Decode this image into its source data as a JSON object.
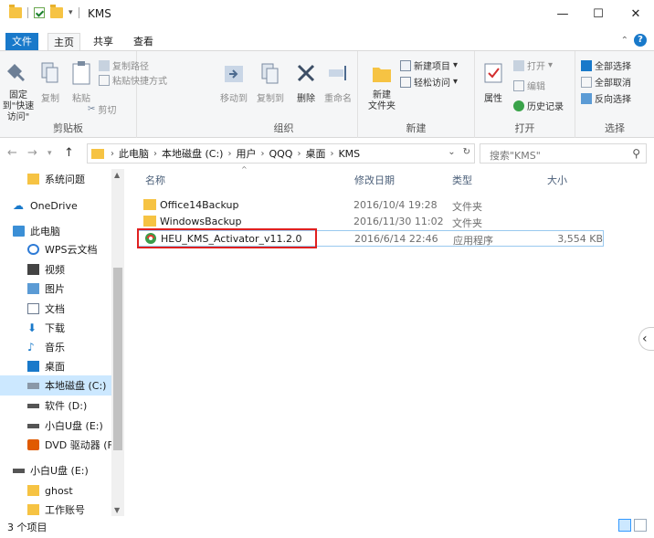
{
  "window": {
    "title": "KMS",
    "minimize": "—",
    "maximize": "☐",
    "close": "✕"
  },
  "ribbon_tabs": {
    "file": "文件",
    "home": "主页",
    "share": "共享",
    "view": "查看"
  },
  "ribbon": {
    "clipboard": {
      "pin": "固定到\"快速访问\"",
      "copy": "复制",
      "paste": "粘贴",
      "copy_path": "复制路径",
      "paste_shortcut": "粘贴快捷方式",
      "cut": "剪切",
      "label": "剪贴板"
    },
    "organize": {
      "move_to": "移动到",
      "copy_to": "复制到",
      "delete": "删除",
      "rename": "重命名",
      "label": "组织"
    },
    "new": {
      "new_folder": "新建\n文件夹",
      "new_item": "新建项目",
      "easy_access": "轻松访问",
      "label": "新建"
    },
    "open": {
      "properties": "属性",
      "open": "打开",
      "edit": "编辑",
      "history": "历史记录",
      "label": "打开"
    },
    "select": {
      "select_all": "全部选择",
      "select_none": "全部取消",
      "invert": "反向选择",
      "label": "选择"
    }
  },
  "address": {
    "crumbs": [
      "此电脑",
      "本地磁盘 (C:)",
      "用户",
      "QQQ",
      "桌面",
      "KMS"
    ],
    "search_placeholder": "搜索\"KMS\""
  },
  "nav": {
    "items": [
      {
        "label": "系统问题",
        "icon": "folder"
      },
      {
        "label": "OneDrive",
        "icon": "cloud"
      },
      {
        "label": "此电脑",
        "icon": "pc"
      },
      {
        "label": "WPS云文档",
        "icon": "wps"
      },
      {
        "label": "视频",
        "icon": "video"
      },
      {
        "label": "图片",
        "icon": "picture"
      },
      {
        "label": "文档",
        "icon": "document"
      },
      {
        "label": "下载",
        "icon": "download"
      },
      {
        "label": "音乐",
        "icon": "music"
      },
      {
        "label": "桌面",
        "icon": "desktop"
      },
      {
        "label": "本地磁盘 (C:)",
        "icon": "drive"
      },
      {
        "label": "软件 (D:)",
        "icon": "drive"
      },
      {
        "label": "小白U盘 (E:)",
        "icon": "drive"
      },
      {
        "label": "DVD 驱动器 (F:)",
        "icon": "dvd"
      },
      {
        "label": "小白U盘 (E:)",
        "icon": "drive"
      },
      {
        "label": "ghost",
        "icon": "folder"
      },
      {
        "label": "工作账号",
        "icon": "folder"
      }
    ]
  },
  "columns": {
    "name": "名称",
    "date": "修改日期",
    "type": "类型",
    "size": "大小"
  },
  "files": [
    {
      "name": "Office14Backup",
      "date": "2016/10/4 19:28",
      "type": "文件夹",
      "size": ""
    },
    {
      "name": "WindowsBackup",
      "date": "2016/11/30 11:02",
      "type": "文件夹",
      "size": ""
    },
    {
      "name": "HEU_KMS_Activator_v11.2.0",
      "date": "2016/6/14 22:46",
      "type": "应用程序",
      "size": "3,554 KB"
    }
  ],
  "status": {
    "item_count": "3 个项目"
  },
  "colors": {
    "accent": "#1979ca",
    "highlight_box": "#e02020",
    "folder": "#f6c343"
  }
}
